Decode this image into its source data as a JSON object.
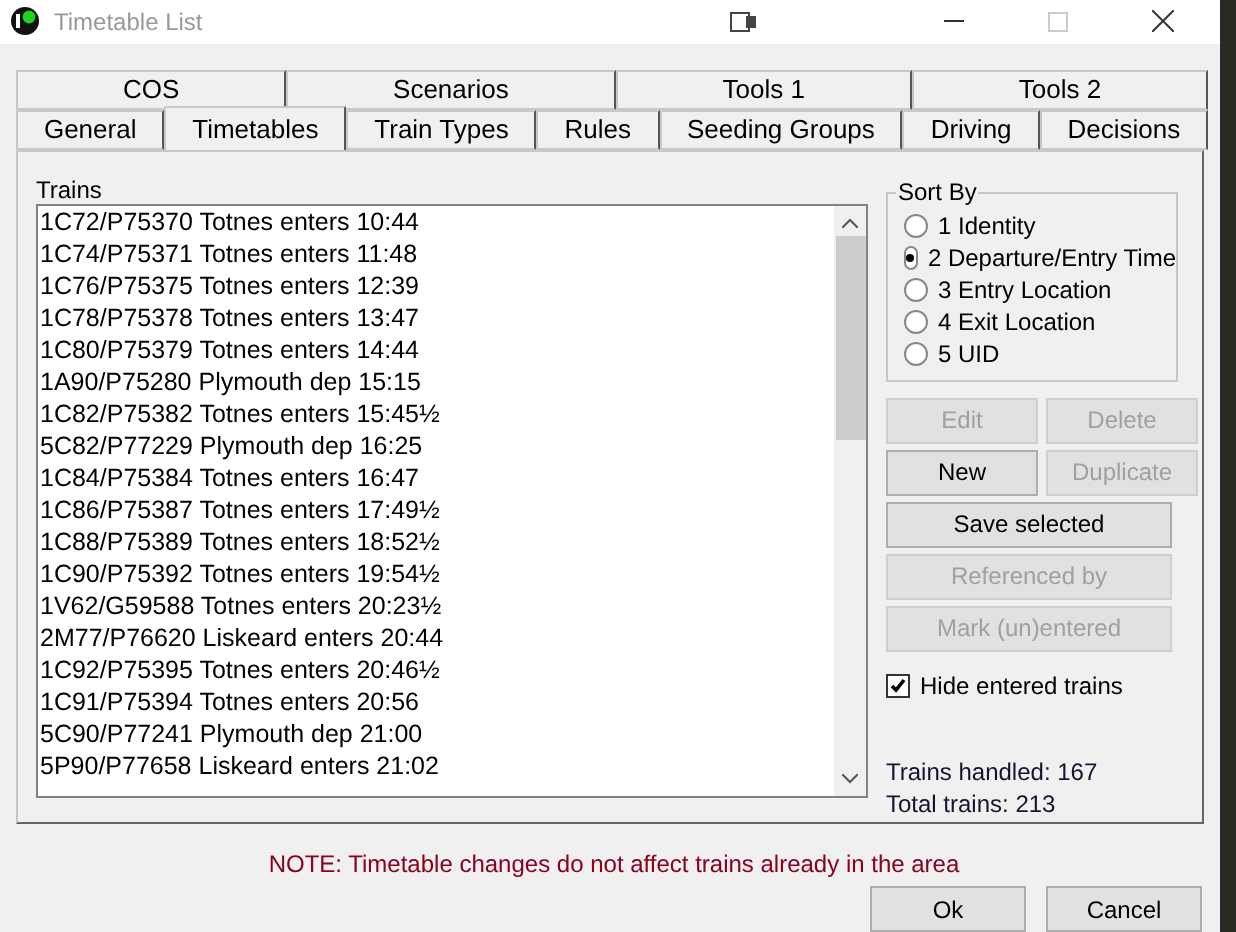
{
  "window": {
    "title": "Timetable List"
  },
  "tab_rows": [
    [
      {
        "label": "COS",
        "selected": false
      },
      {
        "label": "Scenarios",
        "selected": false
      },
      {
        "label": "Tools 1",
        "selected": false
      },
      {
        "label": "Tools 2",
        "selected": false
      }
    ],
    [
      {
        "label": "General",
        "selected": false
      },
      {
        "label": "Timetables",
        "selected": true
      },
      {
        "label": "Train Types",
        "selected": false
      },
      {
        "label": "Rules",
        "selected": false
      },
      {
        "label": "Seeding Groups",
        "selected": false
      },
      {
        "label": "Driving",
        "selected": false
      },
      {
        "label": "Decisions",
        "selected": false
      }
    ]
  ],
  "trains": {
    "label": "Trains",
    "items": [
      "1C72/P75370 Totnes enters 10:44",
      "1C74/P75371 Totnes enters 11:48",
      "1C76/P75375 Totnes enters 12:39",
      "1C78/P75378 Totnes enters 13:47",
      "1C80/P75379 Totnes enters 14:44",
      "1A90/P75280 Plymouth dep 15:15",
      "1C82/P75382 Totnes enters 15:45½",
      "5C82/P77229 Plymouth dep 16:25",
      "1C84/P75384 Totnes enters 16:47",
      "1C86/P75387 Totnes enters 17:49½",
      "1C88/P75389 Totnes enters 18:52½",
      "1C90/P75392 Totnes enters 19:54½",
      "1V62/G59588 Totnes enters 20:23½",
      "2M77/P76620 Liskeard enters 20:44",
      "1C92/P75395 Totnes enters 20:46½",
      "1C91/P75394 Totnes enters 20:56",
      "5C90/P77241 Plymouth dep 21:00",
      "5P90/P77658 Liskeard enters 21:02"
    ]
  },
  "sort_by": {
    "label": "Sort By",
    "options": [
      {
        "label": "1 Identity",
        "selected": false
      },
      {
        "label": "2 Departure/Entry Time",
        "selected": true
      },
      {
        "label": "3 Entry Location",
        "selected": false
      },
      {
        "label": "4 Exit Location",
        "selected": false
      },
      {
        "label": "5 UID",
        "selected": false
      }
    ]
  },
  "buttons": [
    {
      "label": "Edit",
      "disabled": true,
      "kind": "half"
    },
    {
      "label": "Delete",
      "disabled": true,
      "kind": "half"
    },
    {
      "label": "New",
      "disabled": false,
      "kind": "half"
    },
    {
      "label": "Duplicate",
      "disabled": true,
      "kind": "half"
    },
    {
      "label": "Save selected",
      "disabled": false,
      "kind": "full"
    },
    {
      "label": "Referenced by",
      "disabled": true,
      "kind": "full"
    },
    {
      "label": "Mark (un)entered",
      "disabled": true,
      "kind": "full"
    }
  ],
  "hide_entered": {
    "label": "Hide entered trains",
    "checked": true
  },
  "stats": [
    "Trains handled: 167",
    "Total trains: 213"
  ],
  "note": "NOTE: Timetable changes do not affect trains already in the area",
  "dialog_buttons": [
    "Ok",
    "Cancel"
  ]
}
